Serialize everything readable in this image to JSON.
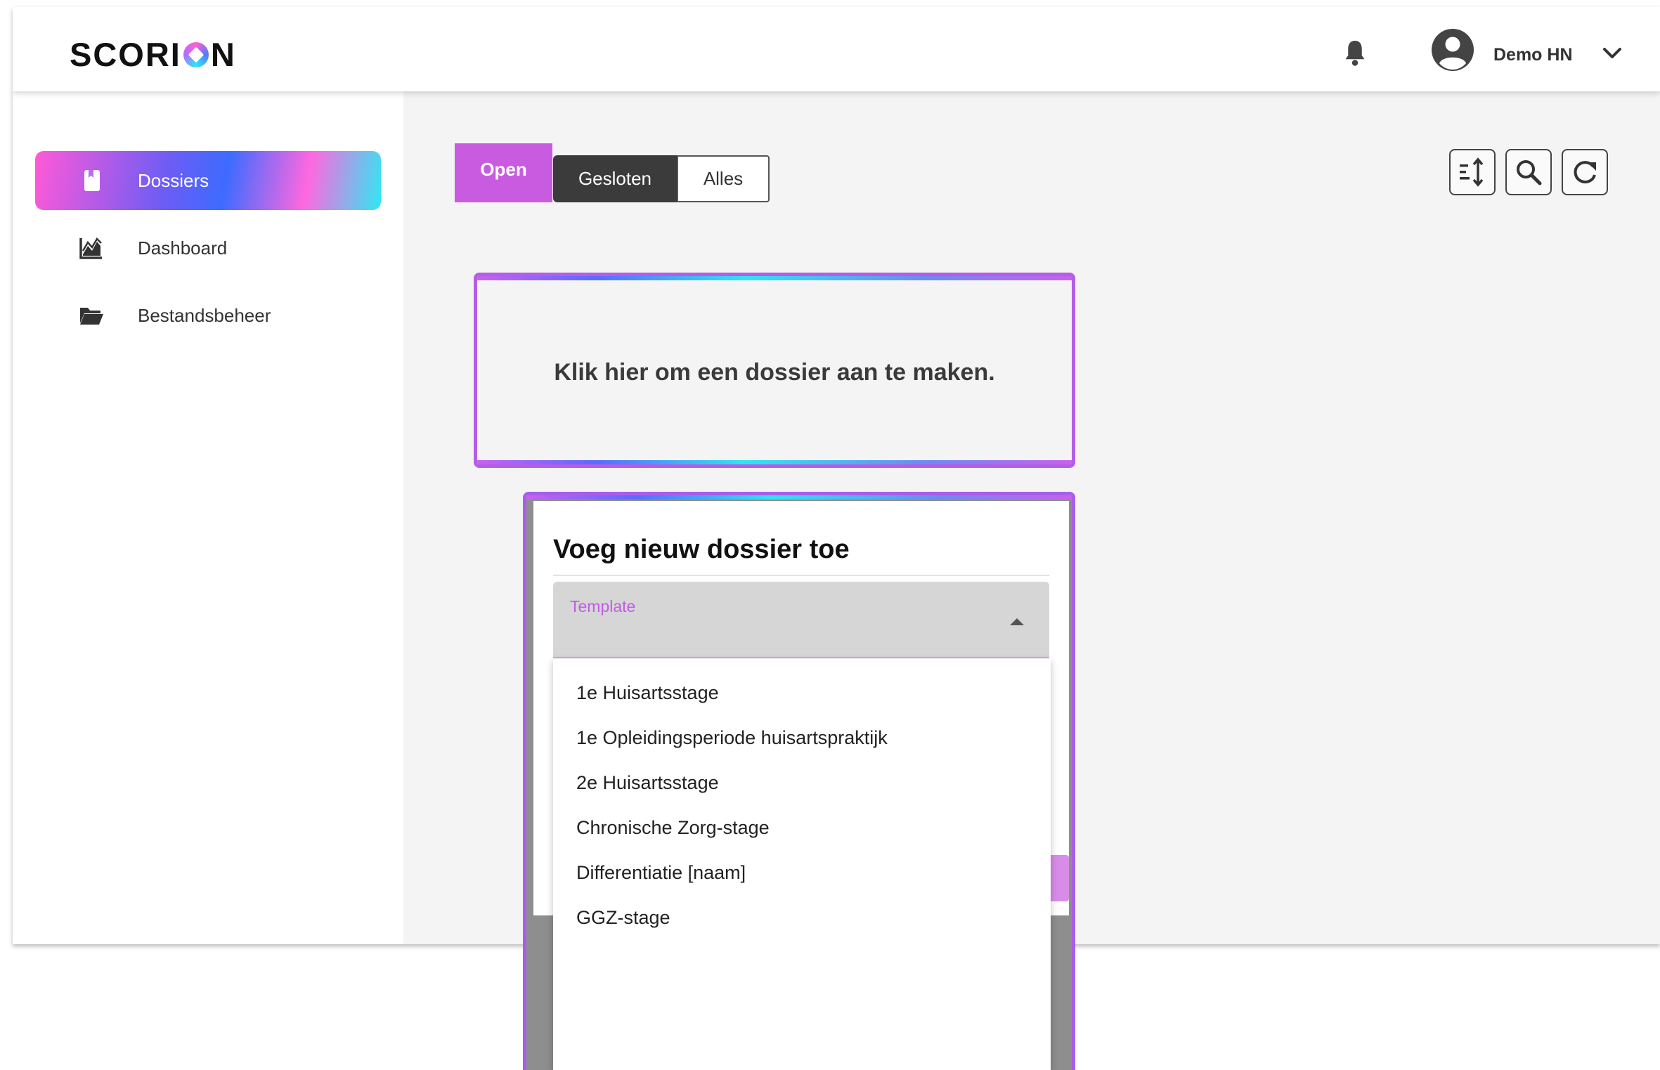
{
  "header": {
    "logo_text_1": "SCORI",
    "logo_text_2": "N",
    "user_name": "Demo HN",
    "icons": [
      "bell-icon",
      "avatar-icon",
      "chevron-down-icon"
    ]
  },
  "sidebar": {
    "items": [
      {
        "label": "Dossiers",
        "icon": "bookmark-icon",
        "active": true
      },
      {
        "label": "Dashboard",
        "icon": "chart-icon",
        "active": false
      },
      {
        "label": "Bestandsbeheer",
        "icon": "folder-icon",
        "active": false
      }
    ]
  },
  "tabs": [
    {
      "label": "Open",
      "active": true
    },
    {
      "label": "Gesloten",
      "active": false
    },
    {
      "label": "Alles",
      "active": false
    }
  ],
  "toolbar": {
    "icons": [
      "sort-icon",
      "search-icon",
      "refresh-icon"
    ]
  },
  "create_card": {
    "text": "Klik hier om een dossier aan te maken."
  },
  "modal": {
    "title": "Voeg nieuw dossier toe",
    "template_label": "Template",
    "options": [
      "1e Huisartsstage",
      "1e Opleidingsperiode huisartspraktijk",
      "2e Huisartsstage",
      "Chronische Zorg-stage",
      "Differentiatie [naam]",
      "GGZ-stage"
    ]
  },
  "colors": {
    "accent": "#c95be0",
    "dark_tab": "#3b3b3b",
    "gradient": [
      "#ff5ad8",
      "#3d6bff",
      "#2fe8f2"
    ]
  }
}
